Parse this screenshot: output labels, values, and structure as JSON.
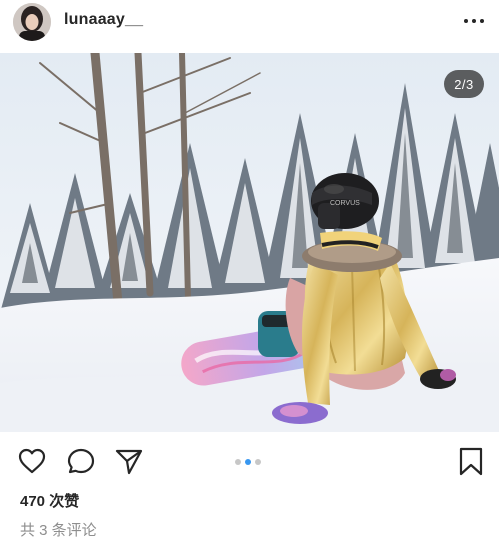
{
  "header": {
    "username": "lunaaay__",
    "avatar_icon": "profile-avatar",
    "more_icon": "more-horizontal-icon"
  },
  "media": {
    "counter": "2/3",
    "current_index": 2,
    "total": 3,
    "helmet_text": "CORVUS"
  },
  "actions": {
    "like_icon": "heart-outline-icon",
    "comment_icon": "comment-bubble-icon",
    "share_icon": "paper-plane-icon",
    "save_icon": "bookmark-outline-icon",
    "carousel_dots": 3,
    "active_dot": 2,
    "active_dot_color": "#3897f0"
  },
  "likes": {
    "text": "470 次赞"
  },
  "comments": {
    "text": "共 3 条评论"
  }
}
